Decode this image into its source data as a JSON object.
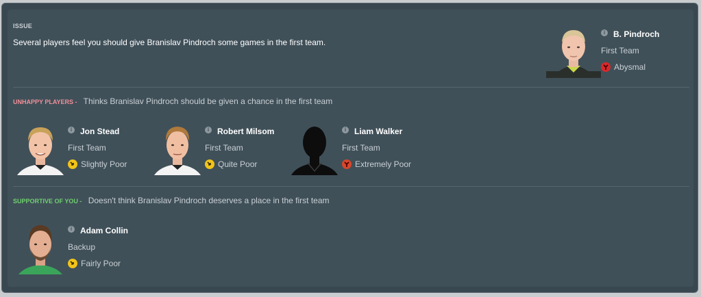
{
  "issue": {
    "label": "ISSUE",
    "text": "Several players feel you should give Branislav Pindroch some games in the first team."
  },
  "subject": {
    "name": "B. Pindroch",
    "role": "First Team",
    "status": "Abysmal",
    "status_color": "#d8282b",
    "jersey_color": "#2b2f2c"
  },
  "unhappy": {
    "tag": "UNHAPPY PLAYERS -",
    "description": "Thinks Branislav Pindroch should be given a chance in the first team",
    "players": [
      {
        "name": "Jon Stead",
        "role": "First Team",
        "status": "Slightly Poor",
        "status_color": "#f0c419",
        "hair": "#c9a25a"
      },
      {
        "name": "Robert Milsom",
        "role": "First Team",
        "status": "Quite Poor",
        "status_color": "#f0c419",
        "hair": "#b07a3c"
      },
      {
        "name": "Liam Walker",
        "role": "First Team",
        "status": "Extremely Poor",
        "status_color": "#d8462b",
        "hair": "#000000"
      }
    ]
  },
  "supportive": {
    "tag": "SUPPORTIVE OF YOU -",
    "description": "Doesn't think Branislav Pindroch deserves a place in the first team",
    "players": [
      {
        "name": "Adam Collin",
        "role": "Backup",
        "status": "Fairly Poor",
        "status_color": "#f0c419",
        "hair": "#5a3a22"
      }
    ]
  },
  "icons": {
    "info": "info-icon",
    "status": "morale-icon",
    "silhouette": "player-silhouette-icon"
  }
}
